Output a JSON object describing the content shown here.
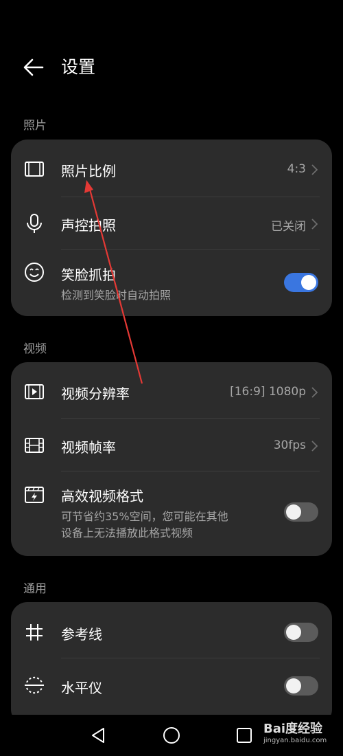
{
  "header": {
    "title": "设置",
    "back_icon": "arrow-left-icon"
  },
  "sections": {
    "photo": {
      "label": "照片",
      "aspect_ratio": {
        "title": "照片比例",
        "value": "4:3",
        "icon": "frame-icon"
      },
      "voice_shot": {
        "title": "声控拍照",
        "value": "已关闭",
        "icon": "microphone-icon"
      },
      "smile_shot": {
        "title": "笑脸抓拍",
        "subtitle": "检测到笑脸时自动拍照",
        "icon": "smile-icon",
        "enabled": true
      }
    },
    "video": {
      "label": "视频",
      "resolution": {
        "title": "视频分辨率",
        "value": "[16:9] 1080p",
        "icon": "video-resolution-icon"
      },
      "frame_rate": {
        "title": "视频帧率",
        "value": "30fps",
        "icon": "film-icon"
      },
      "efficient_format": {
        "title": "高效视频格式",
        "subtitle_line1": "可节省约35%空间，您可能在其他",
        "subtitle_line2": "设备上无法播放此格式视频",
        "icon": "efficient-video-icon",
        "enabled": false
      }
    },
    "general": {
      "label": "通用",
      "grid_lines": {
        "title": "参考线",
        "icon": "grid-icon",
        "enabled": false
      },
      "level": {
        "title": "水平仪",
        "icon": "level-icon",
        "enabled": false
      }
    }
  },
  "watermark": {
    "brand": "Bai度经验",
    "url": "jingyan.baidu.com"
  },
  "colors": {
    "background": "#000000",
    "card": "#2c2c2c",
    "toggle_on": "#3a76e0",
    "annotation_arrow": "#e53935"
  }
}
